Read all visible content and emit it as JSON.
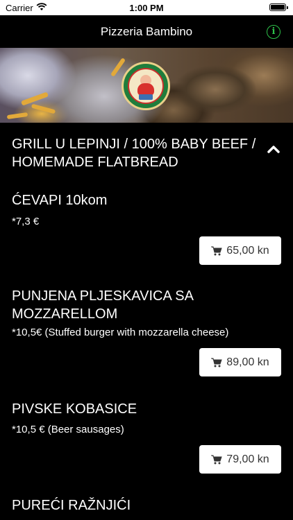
{
  "status_bar": {
    "carrier": "Carrier",
    "time": "1:00 PM"
  },
  "nav": {
    "title": "Pizzeria Bambino",
    "info_icon": "info-icon"
  },
  "section": {
    "title": "GRILL U LEPINJI / 100% BABY BEEF / HOMEMADE FLATBREAD",
    "expanded": true
  },
  "items": [
    {
      "name": "ĆEVAPI 10kom",
      "description": "*7,3 €",
      "price": "65,00 kn"
    },
    {
      "name": "PUNJENA PLJESKAVICA SA MOZZARELLOM",
      "description": "*10,5€ (Stuffed burger with mozzarella cheese)",
      "price": "89,00 kn"
    },
    {
      "name": "PIVSKE KOBASICE",
      "description": "*10,5 € (Beer sausages)",
      "price": "79,00 kn"
    },
    {
      "name": "PUREĆI RAŽNJIĆI",
      "description": "",
      "price": ""
    }
  ],
  "colors": {
    "accent": "#2ec24a",
    "background": "#000000"
  }
}
